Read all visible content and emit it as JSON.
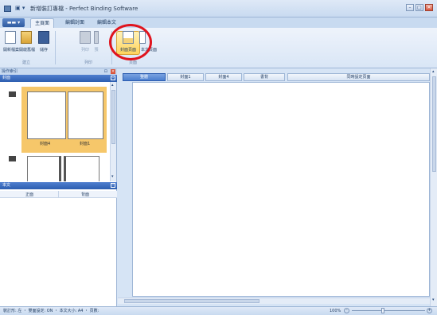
{
  "window": {
    "title": "新增裝訂專檔 - Perfect Binding Software",
    "quick_access": "▣ ▾",
    "buttons": [
      "–",
      "□",
      "✕"
    ]
  },
  "menu_button": "▬▬ ▾",
  "tabs": [
    {
      "label": "主頁面",
      "active": true
    },
    {
      "label": "編輯封面",
      "active": false
    },
    {
      "label": "編輯本文",
      "active": false
    }
  ],
  "ribbon": {
    "buttons": [
      {
        "label": "開新檔案",
        "icon": "new-document-icon",
        "enabled": true
      },
      {
        "label": "開啟舊檔",
        "icon": "open-folder-icon",
        "enabled": true
      },
      {
        "label": "儲存",
        "icon": "save-disk-icon",
        "enabled": true
      },
      {
        "label": "列印",
        "icon": "printer-icon",
        "enabled": false
      },
      {
        "label": "預",
        "icon": "preview-icon",
        "enabled": false
      },
      {
        "label": "封面頁面",
        "icon": "cover-page-icon",
        "enabled": true,
        "selected": true
      },
      {
        "label": "本文頁面",
        "icon": "text-page-icon",
        "enabled": true
      }
    ],
    "groups": [
      "建立",
      "列印",
      "頁面"
    ]
  },
  "left_panel": {
    "title": "操作索引",
    "cover_section": "封面",
    "cover_pages": [
      "封面4",
      "封面1"
    ],
    "text_section": "本文",
    "columns": [
      "正面",
      "背面"
    ]
  },
  "main": {
    "view_tabs": [
      {
        "label": "整體",
        "active": true
      },
      {
        "label": "封面1",
        "active": false
      },
      {
        "label": "封面4",
        "active": false
      },
      {
        "label": "書背",
        "active": false
      },
      {
        "label": "同時設定頁面",
        "active": false
      }
    ]
  },
  "status": {
    "text": "裝訂形: 左 ・ 雙面設定: ON ・ 本文大小: A4 ・ 頁數:",
    "zoom": "100%",
    "zoom_level": 0.4
  },
  "colors": {
    "accent": "#2d5eb0",
    "selected_page": "#f6c76a",
    "highlight": "#e0141e"
  }
}
